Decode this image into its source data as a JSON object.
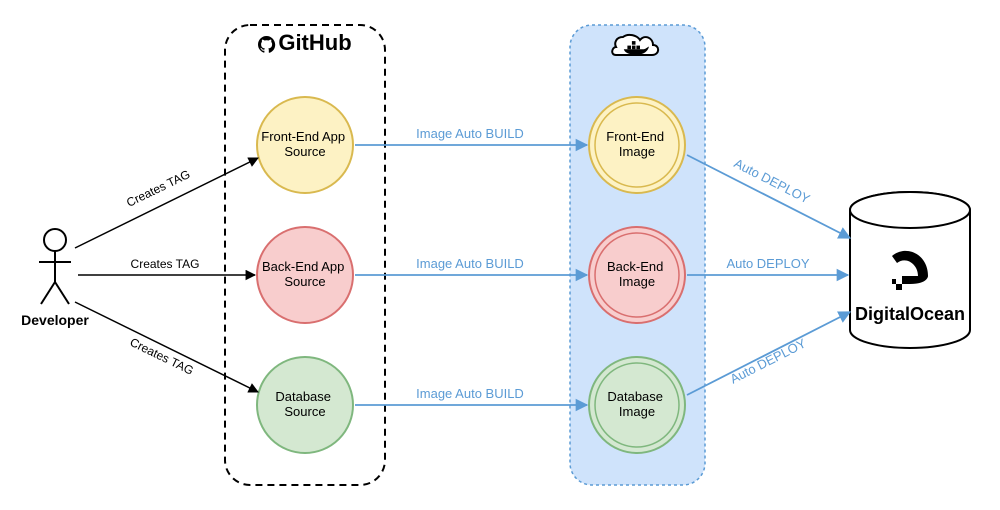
{
  "actor": {
    "label": "Developer"
  },
  "panels": {
    "github_title": "GitHub",
    "do_title": "DigitalOcean"
  },
  "nodes": {
    "front_src": "Front-End App Source",
    "back_src": "Back-End App Source",
    "db_src": "Database Source",
    "front_img": "Front-End Image",
    "back_img": "Back-End Image",
    "db_img": "Database Image"
  },
  "edges": {
    "dev_to_src": "Creates TAG",
    "src_to_img": "Image Auto BUILD",
    "img_to_deploy": "Auto DEPLOY"
  },
  "colors": {
    "yellow_fill": "#fdf2c4",
    "yellow_stroke": "#d9b94f",
    "red_fill": "#f8cdcd",
    "red_stroke": "#d96f6f",
    "green_fill": "#d4e8d1",
    "green_stroke": "#7fb77e",
    "blue_panel_fill": "#cfe3fb",
    "blue_arrow": "#5b9bd5",
    "black": "#000000"
  }
}
